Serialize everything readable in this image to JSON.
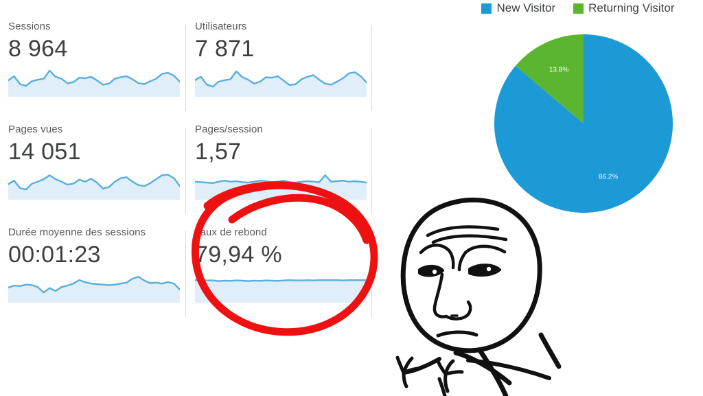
{
  "metrics": [
    {
      "id": "sessions",
      "label": "Sessions",
      "value": "8 964",
      "sparkline": [
        0.55,
        0.72,
        0.4,
        0.33,
        0.52,
        0.58,
        0.62,
        0.95,
        0.7,
        0.62,
        0.44,
        0.48,
        0.66,
        0.64,
        0.7,
        0.55,
        0.38,
        0.42,
        0.62,
        0.68,
        0.72,
        0.6,
        0.44,
        0.4,
        0.52,
        0.62,
        0.82,
        0.86,
        0.74,
        0.5
      ]
    },
    {
      "id": "utilisateurs",
      "label": "Utilisateurs",
      "value": "7 871",
      "sparkline": [
        0.56,
        0.7,
        0.38,
        0.3,
        0.5,
        0.56,
        0.6,
        0.92,
        0.68,
        0.58,
        0.42,
        0.5,
        0.68,
        0.66,
        0.72,
        0.54,
        0.36,
        0.4,
        0.6,
        0.7,
        0.76,
        0.58,
        0.42,
        0.38,
        0.5,
        0.64,
        0.84,
        0.88,
        0.72,
        0.46
      ]
    },
    {
      "id": "pages-vues",
      "label": "Pages vues",
      "value": "14 051",
      "sparkline": [
        0.52,
        0.66,
        0.36,
        0.3,
        0.54,
        0.62,
        0.72,
        0.88,
        0.72,
        0.62,
        0.5,
        0.54,
        0.7,
        0.62,
        0.74,
        0.58,
        0.34,
        0.4,
        0.62,
        0.76,
        0.8,
        0.62,
        0.48,
        0.44,
        0.56,
        0.72,
        0.88,
        0.9,
        0.76,
        0.44
      ]
    },
    {
      "id": "pages-session",
      "label": "Pages/session",
      "value": "1,57",
      "sparkline": [
        0.62,
        0.6,
        0.58,
        0.56,
        0.62,
        0.66,
        0.62,
        0.64,
        0.6,
        0.58,
        0.62,
        0.66,
        0.64,
        0.6,
        0.62,
        0.66,
        0.6,
        0.58,
        0.62,
        0.64,
        0.62,
        0.6,
        0.88,
        0.62,
        0.64,
        0.66,
        0.62,
        0.64,
        0.62,
        0.58
      ]
    },
    {
      "id": "duree-moyenne",
      "label": "Durée moyenne des sessions",
      "value": "00:01:23",
      "sparkline": [
        0.5,
        0.58,
        0.56,
        0.62,
        0.6,
        0.52,
        0.3,
        0.48,
        0.36,
        0.52,
        0.58,
        0.66,
        0.8,
        0.72,
        0.66,
        0.64,
        0.62,
        0.6,
        0.62,
        0.66,
        0.7,
        0.86,
        0.94,
        0.78,
        0.68,
        0.7,
        0.66,
        0.72,
        0.66,
        0.42
      ]
    },
    {
      "id": "taux-de-rebond",
      "label": "Taux de rebond",
      "value": "79,94 %",
      "sparkline": [
        0.8,
        0.8,
        0.79,
        0.79,
        0.76,
        0.78,
        0.77,
        0.79,
        0.78,
        0.76,
        0.78,
        0.77,
        0.79,
        0.78,
        0.77,
        0.79,
        0.8,
        0.79,
        0.79,
        0.8,
        0.79,
        0.8,
        0.8,
        0.8,
        0.8,
        0.79,
        0.8,
        0.8,
        0.8,
        0.8
      ]
    }
  ],
  "chart_data": {
    "type": "pie",
    "title": "",
    "legend_position": "top",
    "categories": [
      "New Visitor",
      "Returning Visitor"
    ],
    "values": [
      86.2,
      13.8
    ],
    "labels": [
      "86.2%",
      "13.8%"
    ],
    "colors": [
      "#1b9ad6",
      "#5cb531"
    ],
    "legend": [
      {
        "label": "New Visitor",
        "color": "#1b9ad6"
      },
      {
        "label": "Returning Visitor",
        "color": "#5cb531"
      }
    ],
    "slices": [
      {
        "name": "New Visitor",
        "value": 86.2,
        "label": "86.2%",
        "color": "#1b9ad6"
      },
      {
        "name": "Returning Visitor",
        "value": 13.8,
        "label": "13.8%",
        "color": "#5cb531"
      }
    ]
  },
  "annotations": {
    "highlight_circle": {
      "name": "red-circle-annotation",
      "color": "#ee1111",
      "target": "Taux de rebond"
    },
    "meme_face": {
      "name": "meme-face-drawing",
      "color": "#111111"
    }
  },
  "theme": {
    "spark_line": "#5aaedc",
    "spark_fill": "#dfeef8",
    "label_color": "#555759",
    "value_color": "#3c4043",
    "divider": "#d9d9d9",
    "accent_blue": "#1b9ad6",
    "accent_green": "#5cb531",
    "annotation_red": "#ee1111"
  }
}
